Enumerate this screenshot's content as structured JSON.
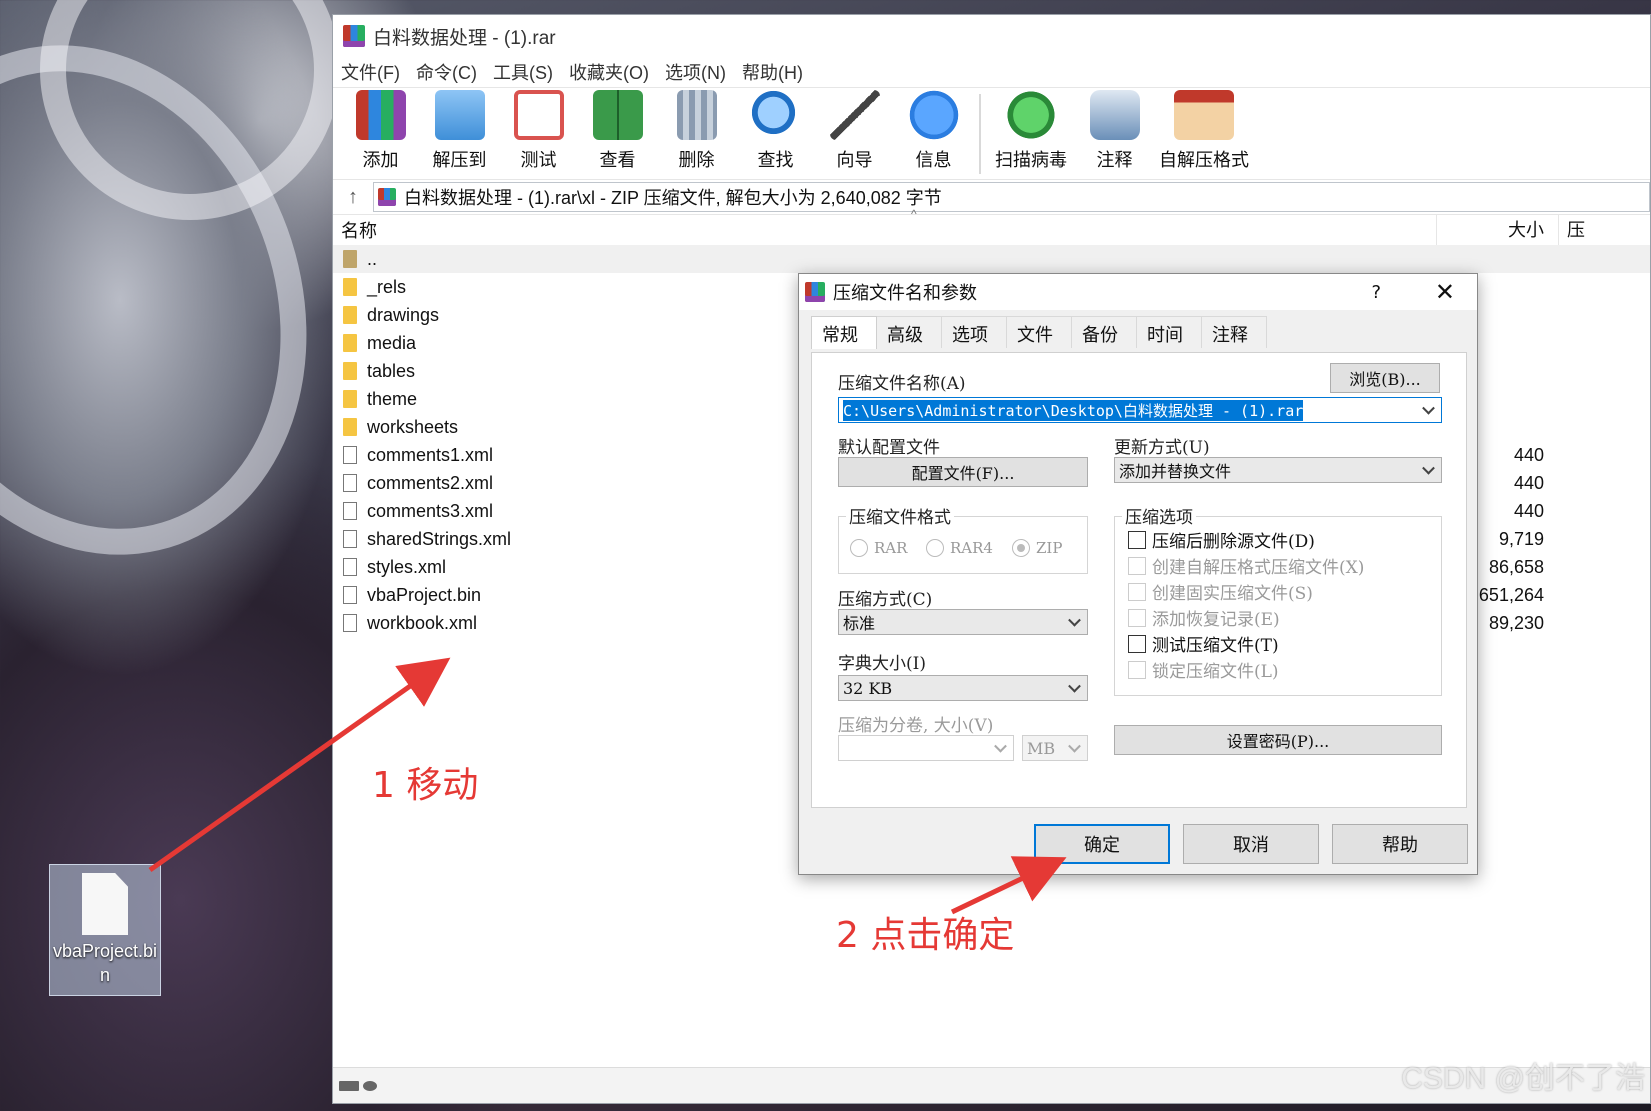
{
  "window": {
    "title": "白料数据处理 - (1).rar",
    "menu": [
      "文件(F)",
      "命令(C)",
      "工具(S)",
      "收藏夹(O)",
      "选项(N)",
      "帮助(H)"
    ],
    "toolbar": [
      {
        "label": "添加",
        "icon": "add-archive-icon",
        "color": "#c0392b"
      },
      {
        "label": "解压到",
        "icon": "extract-folder-icon",
        "color": "#3f8fd8"
      },
      {
        "label": "测试",
        "icon": "test-clipboard-icon",
        "color": "#d9534f"
      },
      {
        "label": "查看",
        "icon": "view-book-icon",
        "color": "#3a9a4a"
      },
      {
        "label": "删除",
        "icon": "delete-trash-icon",
        "color": "#8a9bb0"
      },
      {
        "label": "查找",
        "icon": "find-magnifier-icon",
        "color": "#1f6fc4"
      },
      {
        "label": "向导",
        "icon": "wizard-wand-icon",
        "color": "#444444"
      },
      {
        "label": "信息",
        "icon": "info-icon",
        "color": "#2b7de0"
      },
      {
        "label": "扫描病毒",
        "icon": "scan-virus-bug-icon",
        "color": "#37a64a"
      },
      {
        "label": "注释",
        "icon": "comment-icon",
        "color": "#6a8fb8"
      },
      {
        "label": "自解压格式",
        "icon": "sfx-box-icon",
        "color": "#e0a050"
      }
    ],
    "address": "白料数据处理 - (1).rar\\xl - ZIP 压缩文件, 解包大小为 2,640,082 字节",
    "columns": {
      "name": "名称",
      "size": "大小",
      "packed": "压"
    },
    "files": [
      {
        "name": "..",
        "type": "up",
        "size": ""
      },
      {
        "name": "_rels",
        "type": "folder",
        "size": ""
      },
      {
        "name": "drawings",
        "type": "folder",
        "size": ""
      },
      {
        "name": "media",
        "type": "folder",
        "size": ""
      },
      {
        "name": "tables",
        "type": "folder",
        "size": ""
      },
      {
        "name": "theme",
        "type": "folder",
        "size": ""
      },
      {
        "name": "worksheets",
        "type": "folder",
        "size": ""
      },
      {
        "name": "comments1.xml",
        "type": "file",
        "size": "440"
      },
      {
        "name": "comments2.xml",
        "type": "file",
        "size": "440"
      },
      {
        "name": "comments3.xml",
        "type": "file",
        "size": "440"
      },
      {
        "name": "sharedStrings.xml",
        "type": "file",
        "size": "9,719"
      },
      {
        "name": "styles.xml",
        "type": "file",
        "size": "86,658"
      },
      {
        "name": "vbaProject.bin",
        "type": "file",
        "size": "651,264"
      },
      {
        "name": "workbook.xml",
        "type": "file",
        "size": "89,230"
      }
    ]
  },
  "desktop_icon": {
    "label": "vbaProject.bin"
  },
  "dialog": {
    "title": "压缩文件名和参数",
    "help_glyph": "?",
    "close_glyph": "✕",
    "tabs": [
      "常规",
      "高级",
      "选项",
      "文件",
      "备份",
      "时间",
      "注释"
    ],
    "archive_name_label": "压缩文件名称(A)",
    "browse_button": "浏览(B)...",
    "archive_path": "C:\\Users\\Administrator\\Desktop\\白料数据处理 - (1).rar",
    "profile_label": "默认配置文件",
    "profile_button": "配置文件(F)...",
    "update_mode_label": "更新方式(U)",
    "update_mode_value": "添加并替换文件",
    "format_group": "压缩文件格式",
    "formats": [
      {
        "label": "RAR",
        "checked": false
      },
      {
        "label": "RAR4",
        "checked": false
      },
      {
        "label": "ZIP",
        "checked": true
      }
    ],
    "method_label": "压缩方式(C)",
    "method_value": "标准",
    "dict_label": "字典大小(I)",
    "dict_value": "32 KB",
    "split_label": "压缩为分卷, 大小(V)",
    "split_value": "",
    "split_unit": "MB",
    "options_group": "压缩选项",
    "options": [
      {
        "label": "压缩后删除源文件(D)",
        "enabled": true
      },
      {
        "label": "创建自解压格式压缩文件(X)",
        "enabled": false
      },
      {
        "label": "创建固实压缩文件(S)",
        "enabled": false
      },
      {
        "label": "添加恢复记录(E)",
        "enabled": false
      },
      {
        "label": "测试压缩文件(T)",
        "enabled": true
      },
      {
        "label": "锁定压缩文件(L)",
        "enabled": false
      }
    ],
    "password_button": "设置密码(P)...",
    "ok_button": "确定",
    "cancel_button": "取消",
    "help_button": "帮助"
  },
  "annotations": {
    "step1": "1 移动",
    "step2": "2 点击确定",
    "arrow_color": "#e53935"
  },
  "watermark": "CSDN @创不了浩"
}
